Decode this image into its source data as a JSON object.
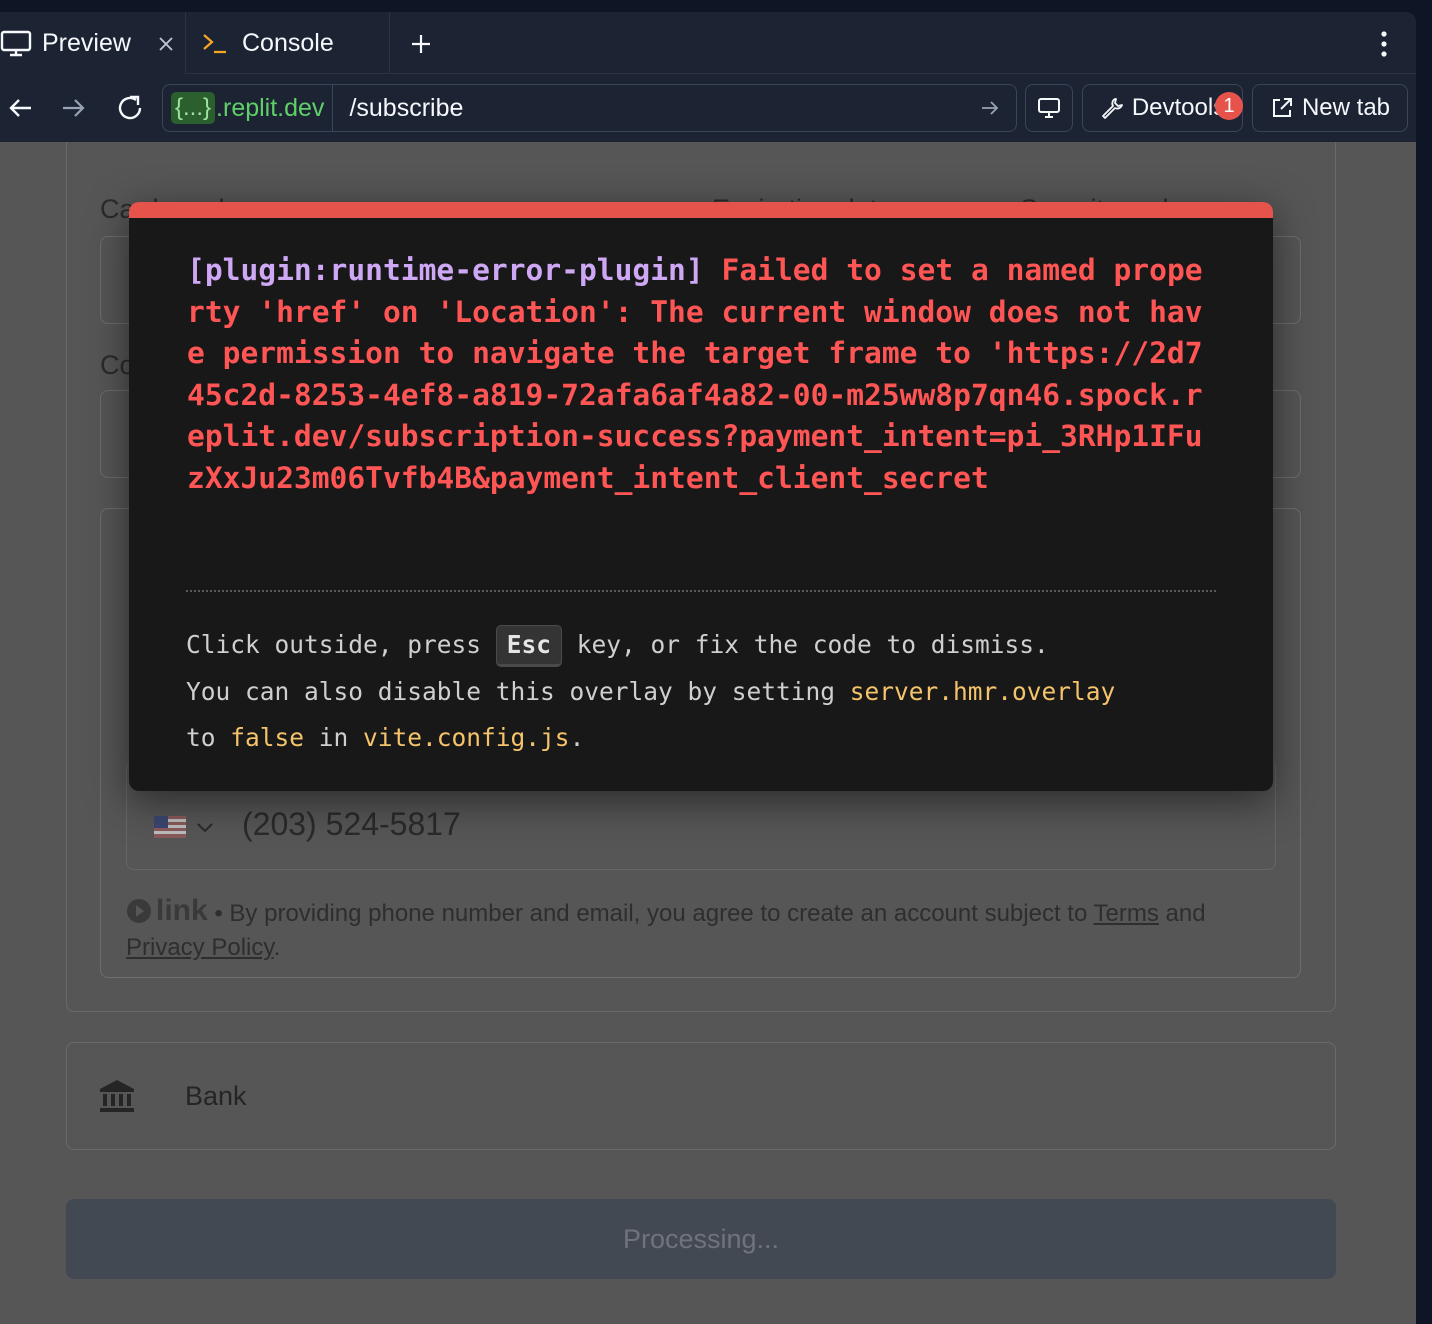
{
  "tabs": {
    "preview_label": "Preview",
    "console_label": "Console",
    "add_label": "+"
  },
  "navbar": {
    "url_badge": "{...}",
    "url_host": ".replit.dev",
    "url_path": "/subscribe",
    "devtools_label": "Devtools",
    "devtools_badge": "1",
    "newtab_label": "New tab"
  },
  "page": {
    "card_number_label": "Card number",
    "expiration_label": "Expiration date",
    "security_label": "Security code",
    "country_label_partial": "Co",
    "phone_value": "(203) 524-5817",
    "link_brand": "link",
    "legal_text_before": " • By providing phone number and email, you agree to create an account subject to ",
    "legal_terms": "Terms",
    "legal_and": " and ",
    "legal_privacy": "Privacy Policy",
    "legal_end": ".",
    "bank_label": "Bank",
    "processing_label": "Processing..."
  },
  "overlay": {
    "plugin_tag": "[plugin:runtime-error-plugin]",
    "error_message": " Failed to set a named property 'href' on 'Location': The current window does not have permission to navigate the target frame to 'https://2d745c2d-8253-4ef8-a819-72afa6af4a82-00-m25ww8p7qn46.spock.replit.dev/subscription-success?payment_intent=pi_3RHp1IFuzXxJu23m06Tvfb4B&payment_intent_client_secret",
    "tip_1": "Click outside, press ",
    "tip_key": "Esc",
    "tip_2": " key, or fix the code to dismiss.",
    "tip_3": "You can also disable this overlay by setting ",
    "tip_code1": "server.hmr.overlay",
    "tip_4": "to ",
    "tip_code2": "false",
    "tip_5": " in ",
    "tip_code3": "vite.config.js",
    "tip_6": "."
  },
  "colors": {
    "overlay_accent": "#e5534b",
    "plugin_color": "#cea8f4",
    "error_color": "#ff5555",
    "code_color": "#f5c36a",
    "host_color": "#5fd068"
  }
}
